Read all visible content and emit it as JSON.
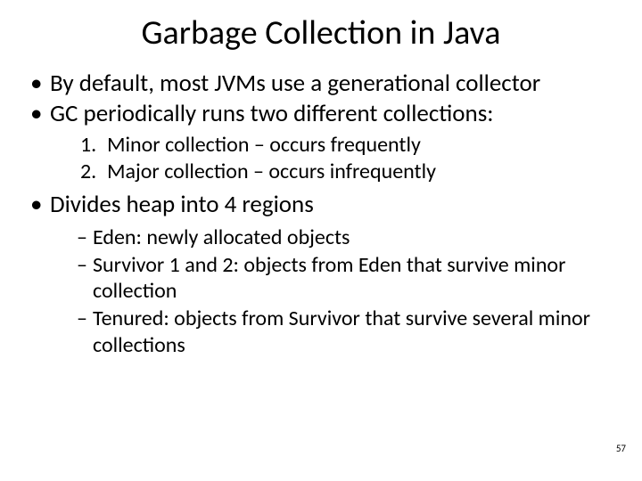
{
  "title": "Garbage Collection in Java",
  "bullets": {
    "b1": "By default, most JVMs use a generational collector",
    "b2": "GC periodically runs two different collections:",
    "b3": "Divides heap into 4 regions"
  },
  "numbered": {
    "n1": "Minor collection – occurs frequently",
    "n2": "Major collection – occurs infrequently"
  },
  "dash": {
    "d1": "Eden: newly allocated objects",
    "d2": "Survivor 1 and 2: objects from Eden that survive minor collection",
    "d3": "Tenured: objects from Survivor that survive several minor collections"
  },
  "page_number": "57"
}
